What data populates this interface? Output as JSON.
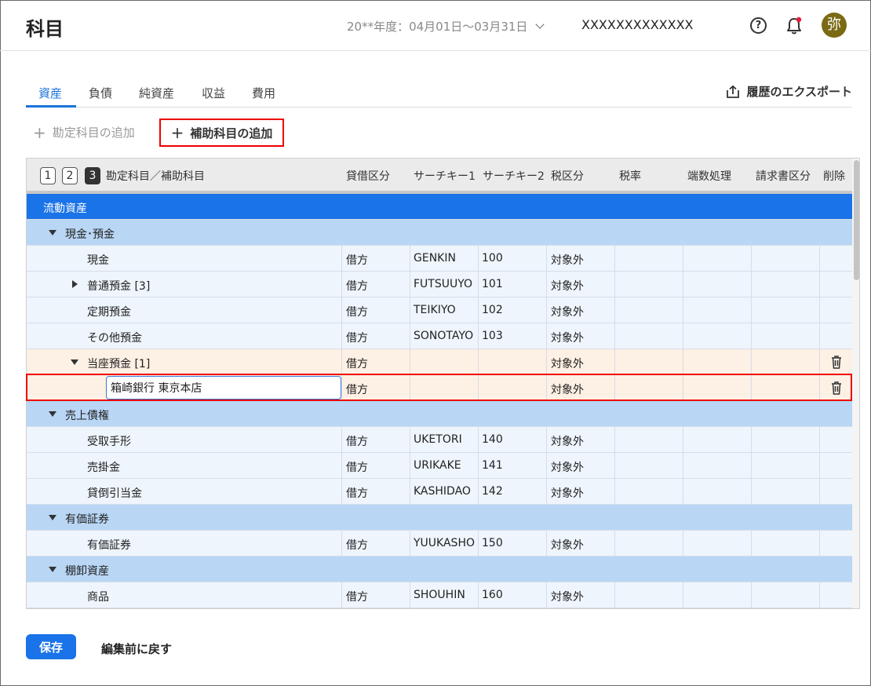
{
  "header": {
    "title": "科目",
    "fiscal_year": "20**年度：04月01日〜03月31日",
    "company": "XXXXXXXXXXXXX",
    "avatar": "弥"
  },
  "tabs": [
    {
      "label": "資産",
      "active": true
    },
    {
      "label": "負債"
    },
    {
      "label": "純資産"
    },
    {
      "label": "収益"
    },
    {
      "label": "費用"
    }
  ],
  "export_label": "履歴のエクスポート",
  "actions": {
    "add_account": "勘定科目の追加",
    "add_sub_account": "補助科目の追加"
  },
  "table": {
    "levels": [
      "1",
      "2",
      "3"
    ],
    "headers": {
      "name": "勘定科目／補助科目",
      "debit_credit": "貸借区分",
      "search1": "サーチキー1",
      "search2": "サーチキー2",
      "tax_class": "税区分",
      "tax_rate": "税率",
      "rounding": "端数処理",
      "invoice": "請求書区分",
      "delete": "削除"
    },
    "rows": [
      {
        "type": "major",
        "name": "流動資産"
      },
      {
        "type": "group",
        "name": "現金･預金"
      },
      {
        "type": "item",
        "name": "現金",
        "dc": "借方",
        "s1": "GENKIN",
        "s2": "100",
        "tax": "対象外"
      },
      {
        "type": "item",
        "name": "普通預金 [3]",
        "dc": "借方",
        "s1": "FUTSUUYO",
        "s2": "101",
        "tax": "対象外"
      },
      {
        "type": "item",
        "name": "定期預金",
        "dc": "借方",
        "s1": "TEIKIYO",
        "s2": "102",
        "tax": "対象外"
      },
      {
        "type": "item",
        "name": "その他預金",
        "dc": "借方",
        "s1": "SONOTAYO",
        "s2": "103",
        "tax": "対象外"
      },
      {
        "type": "sel",
        "name": "当座預金 [1]",
        "dc": "借方",
        "s1": "",
        "s2": "",
        "tax": "対象外"
      },
      {
        "type": "sub",
        "name": "箱崎銀行 東京本店",
        "dc": "借方",
        "s1": "",
        "s2": "",
        "tax": "対象外"
      },
      {
        "type": "group",
        "name": "売上債権"
      },
      {
        "type": "item",
        "name": "受取手形",
        "dc": "借方",
        "s1": "UKETORI",
        "s2": "140",
        "tax": "対象外"
      },
      {
        "type": "item",
        "name": "売掛金",
        "dc": "借方",
        "s1": "URIKAKE",
        "s2": "141",
        "tax": "対象外"
      },
      {
        "type": "item",
        "name": "貸倒引当金",
        "dc": "借方",
        "s1": "KASHIDAO",
        "s2": "142",
        "tax": "対象外"
      },
      {
        "type": "group",
        "name": "有価証券"
      },
      {
        "type": "item",
        "name": "有価証券",
        "dc": "借方",
        "s1": "YUUKASHO",
        "s2": "150",
        "tax": "対象外"
      },
      {
        "type": "group",
        "name": "棚卸資産"
      },
      {
        "type": "item",
        "name": "商品",
        "dc": "借方",
        "s1": "SHOUHIN",
        "s2": "160",
        "tax": "対象外"
      }
    ]
  },
  "footer": {
    "save": "保存",
    "revert": "編集前に戻す"
  }
}
